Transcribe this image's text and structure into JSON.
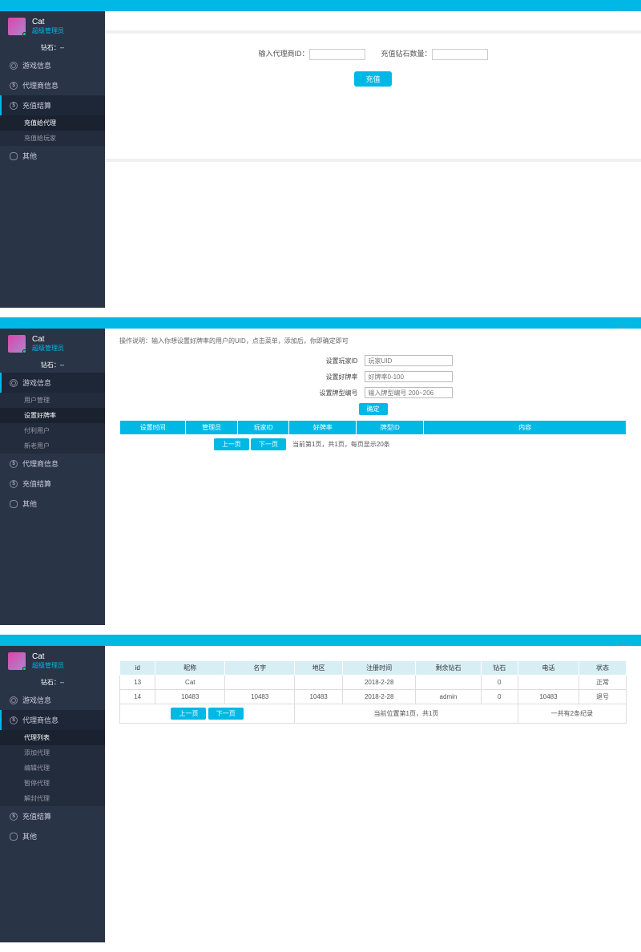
{
  "user": {
    "name": "Cat",
    "role": "超级管理员",
    "balance": "钻石：--"
  },
  "panel1": {
    "nav": [
      "游戏信息",
      "代理商信息",
      "充值结算"
    ],
    "sub": [
      "充值给代理",
      "充值给玩家"
    ],
    "nav_last": "其他",
    "form": {
      "label1": "输入代理商ID：",
      "label2": "充值钻石数量：",
      "btn": "充值"
    }
  },
  "panel2": {
    "nav": [
      "游戏信息"
    ],
    "sub": [
      "用户管理",
      "设置好牌率",
      "付利用户",
      "新老用户"
    ],
    "nav_rest": [
      "代理商信息",
      "充值结算",
      "其他"
    ],
    "hint": "操作说明：输入你想设置好牌率的用户的UID，点击菜单，添加后，你即确定即可",
    "form": {
      "row1_label": "设置玩家ID",
      "row1_ph": "玩家UID",
      "row2_label": "设置好牌率",
      "row2_ph": "好牌率0-100",
      "row3_label": "设置牌型编号",
      "row3_ph": "输入牌型编号 200~206",
      "btn": "确定"
    },
    "thead": [
      "设置时间",
      "管理员",
      "玩家ID",
      "好牌率",
      "牌型ID",
      "内容"
    ],
    "pager": {
      "prev": "上一页",
      "next": "下一页",
      "info": "当前第1页，共1页，每页显示20条"
    }
  },
  "panel3": {
    "nav": [
      "游戏信息",
      "代理商信息"
    ],
    "sub": [
      "代理列表",
      "添加代理",
      "编辑代理",
      "暂停代理",
      "解封代理"
    ],
    "nav_rest": [
      "充值结算",
      "其他"
    ],
    "thead": [
      "id",
      "昵称",
      "名字",
      "地区",
      "注册时间",
      "剩余钻石",
      "钻石",
      "电话",
      "状态"
    ],
    "rows": [
      {
        "id": "13",
        "nick": "Cat",
        "name": "",
        "region": "",
        "time": "2018-2-28",
        "remain": "",
        "diamond": "0",
        "phone": "",
        "status": "正常"
      },
      {
        "id": "14",
        "nick": "10483",
        "name": "10483",
        "region": "10483",
        "time": "2018-2-28",
        "remain": "admin",
        "diamond": "0",
        "phone": "10483",
        "status": "退号"
      }
    ],
    "pager": {
      "prev": "上一页",
      "next": "下一页",
      "info1": "当前位置第1页，共1页",
      "info2": "一共有2条纪录"
    }
  }
}
